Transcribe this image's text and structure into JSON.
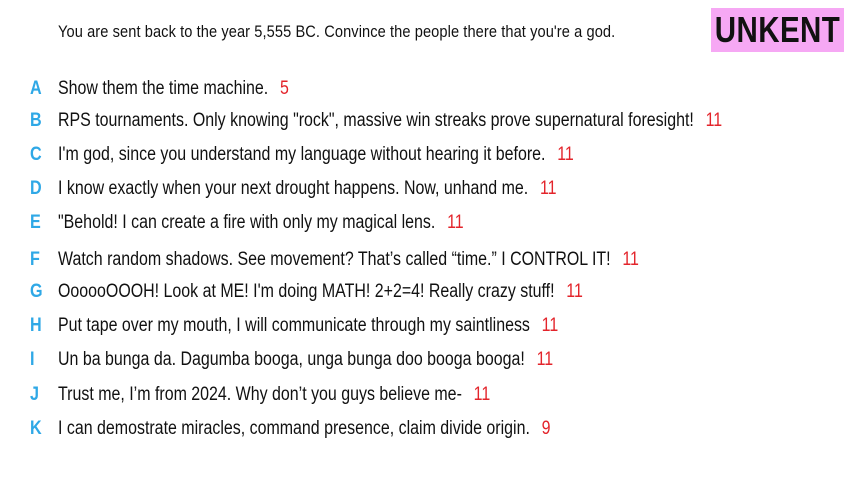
{
  "prompt": "You are sent back to the year 5,555 BC. Convince the people there that you're a god.",
  "logo": "UNKENT",
  "colors": {
    "letter": "#2fa8e6",
    "score": "#e3242b",
    "logo_bg": "#f6a8f4"
  },
  "answers": [
    {
      "letter": "A",
      "text": "Show them the time machine.",
      "score": "5"
    },
    {
      "letter": "B",
      "text": "RPS tournaments. Only knowing \"rock\", massive win streaks prove supernatural foresight!",
      "score": "11"
    },
    {
      "letter": "C",
      "text": "I'm god, since you understand my language without hearing it before.",
      "score": "11"
    },
    {
      "letter": "D",
      "text": "I know exactly when your next drought happens. Now, unhand me.",
      "score": "11"
    },
    {
      "letter": "E",
      "text": "\"Behold! I can create a fire with only my magical lens.",
      "score": "11"
    },
    {
      "letter": "F",
      "text": "Watch random shadows. See movement? That’s called “time.” I CONTROL IT!",
      "score": "11"
    },
    {
      "letter": "G",
      "text": "OooooOOOH! Look at ME! I'm doing MATH! 2+2=4! Really crazy stuff!",
      "score": "11"
    },
    {
      "letter": "H",
      "text": "Put tape over my mouth, I will communicate through my saintliness",
      "score": "11"
    },
    {
      "letter": "I",
      "text": "Un ba bunga da. Dagumba booga, unga bunga doo booga booga!",
      "score": "11"
    },
    {
      "letter": "J",
      "text": "Trust me, I’m from 2024. Why don’t you guys believe me-",
      "score": "11"
    },
    {
      "letter": "K",
      "text": "I can demostrate miracles, command presence, claim divide origin.",
      "score": "9"
    }
  ]
}
